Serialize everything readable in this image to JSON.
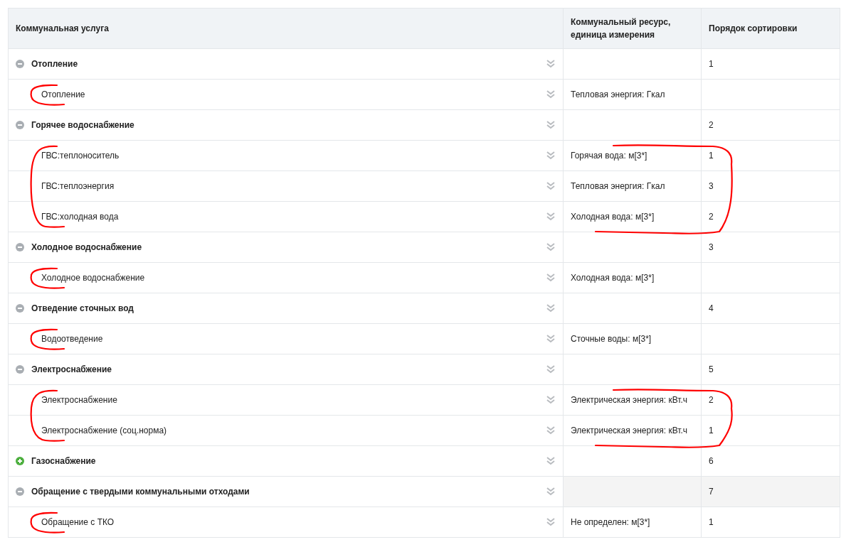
{
  "columns": [
    "Коммунальная услуга",
    "Коммунальный ресурс, единица измерения",
    "Порядок сортировки"
  ],
  "groups": [
    {
      "name": "Отопление",
      "expanded": true,
      "highlighted": false,
      "order": "1",
      "children": [
        {
          "name": "Отопление",
          "resource": "Тепловая энергия: Гкал",
          "bracketed": true,
          "circled": false
        }
      ]
    },
    {
      "name": "Горячее водоснабжение",
      "expanded": true,
      "highlighted": false,
      "order": "2",
      "children": [
        {
          "name": "ГВС:теплоноситель",
          "resource": "Горячая вода: м[3*]",
          "order": "1",
          "bracketed": true,
          "circled": true
        },
        {
          "name": "ГВС:теплоэнергия",
          "resource": "Тепловая энергия: Гкал",
          "order": "3",
          "bracketed": true,
          "circled": true
        },
        {
          "name": "ГВС:холодная вода",
          "resource": "Холодная вода: м[3*]",
          "order": "2",
          "bracketed": true,
          "circled": true
        }
      ]
    },
    {
      "name": "Холодное водоснабжение",
      "expanded": true,
      "highlighted": false,
      "order": "3",
      "children": [
        {
          "name": "Холодное водоснабжение",
          "resource": "Холодная вода: м[3*]",
          "bracketed": true,
          "circled": false
        }
      ]
    },
    {
      "name": "Отведение сточных вод",
      "expanded": true,
      "highlighted": false,
      "order": "4",
      "children": [
        {
          "name": "Водоотведение",
          "resource": "Сточные воды: м[3*]",
          "bracketed": true,
          "circled": false
        }
      ]
    },
    {
      "name": "Электроснабжение",
      "expanded": true,
      "highlighted": false,
      "order": "5",
      "children": [
        {
          "name": "Электроснабжение",
          "resource": "Электрическая энергия: кВт.ч",
          "order": "2",
          "bracketed": true,
          "circled": true
        },
        {
          "name": "Электроснабжение (соц.норма)",
          "resource": "Электрическая энергия: кВт.ч",
          "order": "1",
          "bracketed": true,
          "circled": true
        }
      ]
    },
    {
      "name": "Газоснабжение",
      "expanded": false,
      "highlighted": false,
      "order": "6"
    },
    {
      "name": "Обращение с твердыми коммунальными отходами",
      "expanded": true,
      "highlighted": true,
      "order": "7",
      "children": [
        {
          "name": "Обращение с ТКО",
          "resource": "Не определен: м[3*]",
          "order": "1",
          "bracketed": true,
          "circled": false
        }
      ]
    }
  ]
}
